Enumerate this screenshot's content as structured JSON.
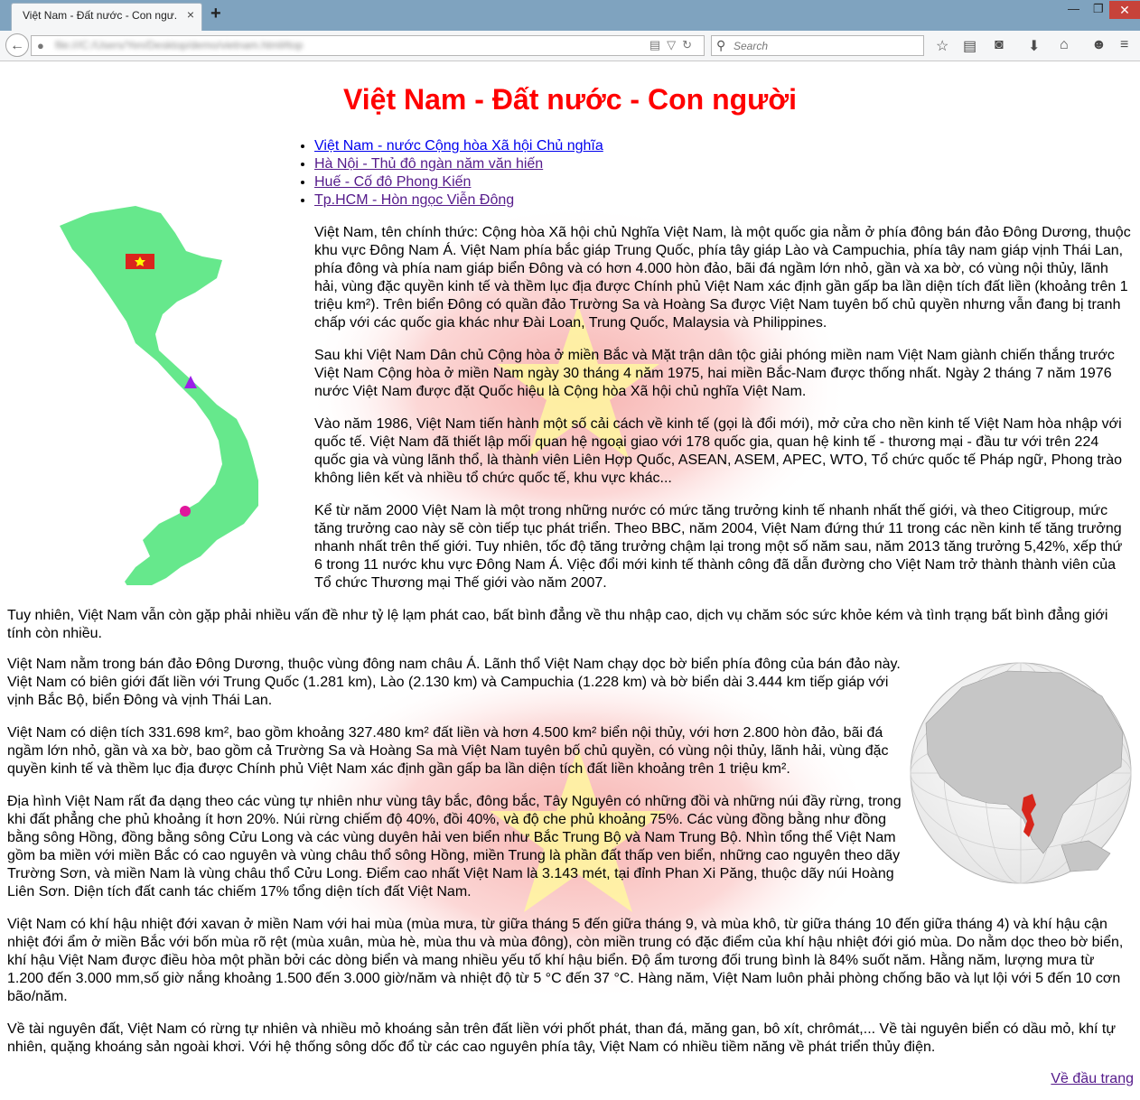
{
  "browser": {
    "tab_title": "Việt Nam - Đất nước - Con ngư...",
    "tab_close": "×",
    "new_tab": "+",
    "window_controls": [
      "—",
      "❐",
      "✕"
    ],
    "url": "file:///C:/Users/Yen/Desktop/demo/vietnam.html#top",
    "search_placeholder": "Search",
    "back_glyph": "←"
  },
  "page": {
    "title": "Việt Nam - Đất nước - Con người",
    "topics": [
      "Việt Nam - nước Cộng hòa Xã hội Chủ nghĩa",
      "Hà Nội - Thủ đô ngàn năm văn hiến",
      "Huế - Cố đô Phong Kiến",
      "Tp.HCM - Hòn ngọc Viễn Đông"
    ],
    "paragraphs": [
      "Việt Nam, tên chính thức: Cộng hòa Xã hội chủ Nghĩa Việt Nam, là một quốc gia nằm ở phía đông bán đảo Đông Dương, thuộc khu vực Đông Nam Á. Việt Nam phía bắc giáp Trung Quốc, phía tây giáp Lào và Campuchia, phía tây nam giáp vịnh Thái Lan, phía đông và phía nam giáp biển Đông và có hơn 4.000 hòn đảo, bãi đá ngầm lớn nhỏ, gần và xa bờ, có vùng nội thủy, lãnh hải, vùng đặc quyền kinh tế và thềm lục địa được Chính phủ Việt Nam xác định gần gấp ba lần diện tích đất liền (khoảng trên 1 triệu km²). Trên biển Đông có quần đảo Trường Sa và Hoàng Sa được Việt Nam tuyên bố chủ quyền nhưng vẫn đang bị tranh chấp với các quốc gia khác như Đài Loan, Trung Quốc, Malaysia và Philippines.",
      "Sau khi Việt Nam Dân chủ Cộng hòa ở miền Bắc và Mặt trận dân tộc giải phóng miền nam Việt Nam giành chiến thắng trước Việt Nam Cộng hòa ở miền Nam ngày 30 tháng 4 năm 1975, hai miền Bắc-Nam được thống nhất. Ngày 2 tháng 7 năm 1976 nước Việt Nam được đặt Quốc hiệu là Cộng hòa Xã hội chủ nghĩa Việt Nam.",
      "Vào năm 1986, Việt Nam tiến hành một số cải cách về kinh tế (gọi là đổi mới), mở cửa cho nền kinh tế Việt Nam hòa nhập với quốc tế. Việt Nam đã thiết lập mối quan hệ ngoại giao với 178 quốc gia, quan hệ kinh tế - thương mại - đầu tư với trên 224 quốc gia và vùng lãnh thổ, là thành viên Liên Hợp Quốc, ASEAN, ASEM, APEC, WTO, Tổ chức quốc tế Pháp ngữ, Phong trào không liên kết và nhiều tổ chức quốc tế, khu vực khác...",
      "Kể từ năm 2000 Việt Nam là một trong những nước có mức tăng trưởng kinh tế nhanh nhất thế giới, và theo Citigroup, mức tăng trưởng cao này sẽ còn tiếp tục phát triển. Theo BBC, năm 2004, Việt Nam đứng thứ 11 trong các nền kinh tế tăng trưởng nhanh nhất trên thế giới. Tuy nhiên, tốc độ tăng trưởng chậm lại trong một số năm sau, năm 2013 tăng trưởng 5,42%, xếp thứ 6 trong 11 nước khu vực Đông Nam Á. Việc đổi mới kinh tế thành công đã dẫn đường cho Việt Nam trở thành thành viên của Tổ chức Thương mại Thế giới vào năm 2007.",
      "Tuy nhiên, Việt Nam vẫn còn gặp phải nhiều vấn đề như tỷ lệ lạm phát cao, bất bình đẳng về thu nhập cao, dịch vụ chăm sóc sức khỏe kém và tình trạng bất bình đẳng giới tính còn nhiều.",
      "Việt Nam nằm trong bán đảo Đông Dương, thuộc vùng đông nam châu Á. Lãnh thổ Việt Nam chạy dọc bờ biển phía đông của bán đảo này. Việt Nam có biên giới đất liền với Trung Quốc (1.281 km), Lào (2.130 km) và Campuchia (1.228 km) và bờ biển dài 3.444 km tiếp giáp với vịnh Bắc Bộ, biển Đông và vịnh Thái Lan.",
      "Việt Nam có diện tích 331.698 km², bao gồm khoảng 327.480 km² đất liền và hơn 4.500 km² biển nội thủy, với hơn 2.800 hòn đảo, bãi đá ngầm lớn nhỏ, gần và xa bờ, bao gồm cả Trường Sa và Hoàng Sa mà Việt Nam tuyên bố chủ quyền, có vùng nội thủy, lãnh hải, vùng đặc quyền kinh tế và thềm lục địa được Chính phủ Việt Nam xác định gần gấp ba lần diện tích đất liền khoảng trên 1 triệu km².",
      "Địa hình Việt Nam rất đa dạng theo các vùng tự nhiên như vùng tây bắc, đông bắc, Tây Nguyên có những đồi và những núi đầy rừng, trong khi đất phẳng che phủ khoảng ít hơn 20%. Núi rừng chiếm độ 40%, đồi 40%, và độ che phủ khoảng 75%. Các vùng đồng bằng như đồng bằng sông Hồng, đồng bằng sông Cửu Long và các vùng duyên hải ven biển như Bắc Trung Bộ và Nam Trung Bộ. Nhìn tổng thể Việt Nam gồm ba miền với miền Bắc có cao nguyên và vùng châu thổ sông Hồng, miền Trung là phần đất thấp ven biển, những cao nguyên theo dãy Trường Sơn, và miền Nam là vùng châu thổ Cửu Long. Điểm cao nhất Việt Nam là 3.143 mét, tại đỉnh Phan Xi Păng, thuộc dãy núi Hoàng Liên Sơn. Diện tích đất canh tác chiếm 17% tổng diện tích đất Việt Nam.",
      "Việt Nam có khí hậu nhiệt đới xavan ở miền Nam với hai mùa (mùa mưa, từ giữa tháng 5 đến giữa tháng 9, và mùa khô, từ giữa tháng 10 đến giữa tháng 4) và khí hậu cận nhiệt đới ẩm ở miền Bắc với bốn mùa rõ rệt (mùa xuân, mùa hè, mùa thu và mùa đông), còn miền trung có đặc điểm của khí hậu nhiệt đới gió mùa. Do nằm dọc theo bờ biển, khí hậu Việt Nam được điều hòa một phần bởi các dòng biển và mang nhiều yếu tố khí hậu biển. Độ ẩm tương đối trung bình là 84% suốt năm. Hằng năm, lượng mưa từ 1.200 đến 3.000 mm,số giờ nắng khoảng 1.500 đến 3.000 giờ/năm và nhiệt độ từ 5 °C đến 37 °C. Hàng năm, Việt Nam luôn phải phòng chống bão và lụt lội với 5 đến 10 cơn bão/năm.",
      "Về tài nguyên đất, Việt Nam có rừng tự nhiên và nhiều mỏ khoáng sản trên đất liền với phốt phát, than đá, măng gan, bô xít, chrômát,... Về tài nguyên biển có dầu mỏ, khí tự nhiên, quặng khoáng sản ngoài khơi. Với hệ thống sông dốc đổ từ các cao nguyên phía tây, Việt Nam có nhiều tiềm năng về phát triển thủy điện."
    ],
    "back_to_top": "Về đầu trang"
  },
  "colors": {
    "title": "#ff0000",
    "map_land": "#66e88c",
    "flag_red": "#da251d",
    "flag_star": "#ffff00",
    "hue_marker": "#9b1fe8",
    "hcm_marker": "#e0169c"
  }
}
